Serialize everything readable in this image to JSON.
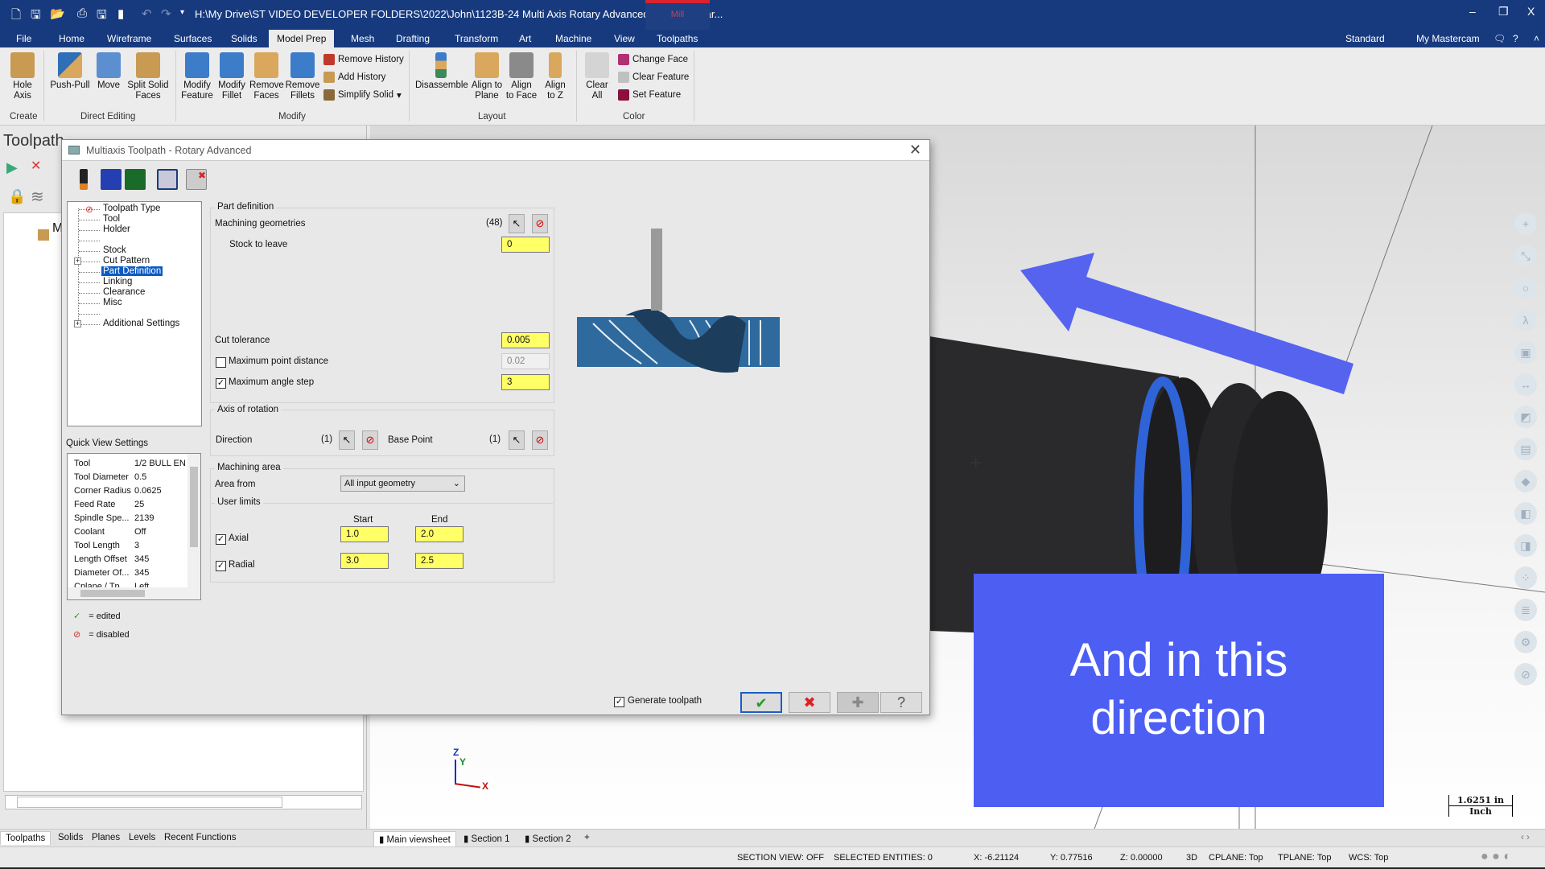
{
  "window": {
    "title": "H:\\My Drive\\ST VIDEO DEVELOPER FOLDERS\\2022\\John\\1123B-24 Multi Axis Rotary Advanced Roughing par...",
    "context_tab": "Mill",
    "minimize": "–",
    "restore": "❐",
    "close": "X"
  },
  "ribbon_tabs": [
    "File",
    "Home",
    "Wireframe",
    "Surfaces",
    "Solids",
    "Model Prep",
    "Mesh",
    "Drafting",
    "Transform",
    "Art",
    "Machine",
    "View",
    "Toolpaths"
  ],
  "active_tab": "Model Prep",
  "ribbon_right": {
    "workspace": "Standard",
    "my_mastercam": "My Mastercam"
  },
  "ribbon": {
    "create": {
      "label": "Create",
      "buttons": [
        "Hole\nAxis"
      ]
    },
    "direct_editing": {
      "label": "Direct Editing",
      "buttons": [
        "Push-Pull",
        "Move",
        "Split Solid\nFaces"
      ]
    },
    "modify": {
      "label": "Modify",
      "buttons": [
        "Modify\nFeature",
        "Modify\nFillet",
        "Remove\nFaces",
        "Remove\nFillets"
      ],
      "small": [
        "Remove History",
        "Add History",
        "Simplify Solid"
      ]
    },
    "layout": {
      "label": "Layout",
      "buttons": [
        "Disassemble",
        "Align to\nPlane",
        "Align\nto Face",
        "Align\nto Z"
      ]
    },
    "color": {
      "label": "Color",
      "buttons": [
        "Clear\nAll"
      ],
      "small": [
        "Change Face",
        "Clear Feature",
        "Set Feature"
      ]
    }
  },
  "left_panel": {
    "header": "Toolpath",
    "tree_root": "M",
    "bottom_tabs": [
      "Toolpaths",
      "Solids",
      "Planes",
      "Levels",
      "Recent Functions"
    ],
    "active_bottom_tab": "Toolpaths"
  },
  "dialog": {
    "title": "Multiaxis Toolpath - Rotary Advanced",
    "tree": [
      {
        "label": "Toolpath Type",
        "icon": "disabled-icon"
      },
      {
        "label": "Tool"
      },
      {
        "label": "Holder"
      },
      {
        "label": ""
      },
      {
        "label": "Stock"
      },
      {
        "label": "Cut Pattern",
        "expandable": true
      },
      {
        "label": "Part Definition",
        "selected": true
      },
      {
        "label": "Linking"
      },
      {
        "label": "Clearance"
      },
      {
        "label": "Misc"
      },
      {
        "label": ""
      },
      {
        "label": "Additional Settings",
        "expandable": true
      }
    ],
    "quick_view": {
      "label": "Quick View Settings",
      "rows": [
        [
          "Tool",
          "1/2 BULL EN"
        ],
        [
          "Tool Diameter",
          "0.5"
        ],
        [
          "Corner Radius",
          "0.0625"
        ],
        [
          "Feed Rate",
          "25"
        ],
        [
          "Spindle Spe...",
          "2139"
        ],
        [
          "Coolant",
          "Off"
        ],
        [
          "Tool Length",
          "3"
        ],
        [
          "Length Offset",
          "345"
        ],
        [
          "Diameter Of...",
          "345"
        ],
        [
          "Cplane / Tp...",
          "Left"
        ]
      ]
    },
    "legend": {
      "edited": "= edited",
      "disabled": "= disabled"
    },
    "part_definition": {
      "title": "Part definition",
      "machining_geometries": "Machining geometries",
      "geometry_count": "(48)",
      "stock_to_leave_label": "Stock to leave",
      "stock_to_leave": "0",
      "cut_tolerance_label": "Cut tolerance",
      "cut_tolerance": "0.005",
      "max_point_distance_label": "Maximum point distance",
      "max_point_distance": "0.02",
      "max_point_distance_checked": false,
      "max_angle_step_label": "Maximum angle step",
      "max_angle_step": "3",
      "max_angle_step_checked": true
    },
    "axis_of_rotation": {
      "title": "Axis of rotation",
      "direction_label": "Direction",
      "direction_count": "(1)",
      "base_point_label": "Base Point",
      "base_point_count": "(1)"
    },
    "machining_area": {
      "title": "Machining area",
      "area_from_label": "Area from",
      "area_from": "All input geometry",
      "user_limits": "User limits",
      "start": "Start",
      "end": "End",
      "axial_label": "Axial",
      "axial_start": "1.0",
      "axial_end": "2.0",
      "radial_label": "Radial",
      "radial_start": "3.0",
      "radial_end": "2.5"
    },
    "generate_toolpath": "Generate toolpath",
    "generate_toolpath_checked": true,
    "buttons": {
      "ok": "✔",
      "cancel": "✖",
      "add": "✚",
      "help": "?"
    }
  },
  "viewport": {
    "overlay_text_1": "And in this",
    "overlay_text_2": "direction",
    "scale_value": "1.6251 in",
    "scale_unit": "Inch",
    "axis_labels": {
      "x": "X",
      "y": "Y",
      "z": "Z"
    },
    "sheet_tabs": [
      "Main viewsheet",
      "Section 1",
      "Section 2",
      "+"
    ],
    "overlay_color": "#4d5ff2"
  },
  "status": {
    "section_view": "SECTION VIEW: OFF",
    "selected": "SELECTED ENTITIES: 0",
    "x": "X:  -6.21124",
    "y": "Y:  0.77516",
    "z": "Z:  0.00000",
    "mode": "3D",
    "cplane": "CPLANE: Top",
    "tplane": "TPLANE: Top",
    "wcs": "WCS: Top"
  }
}
